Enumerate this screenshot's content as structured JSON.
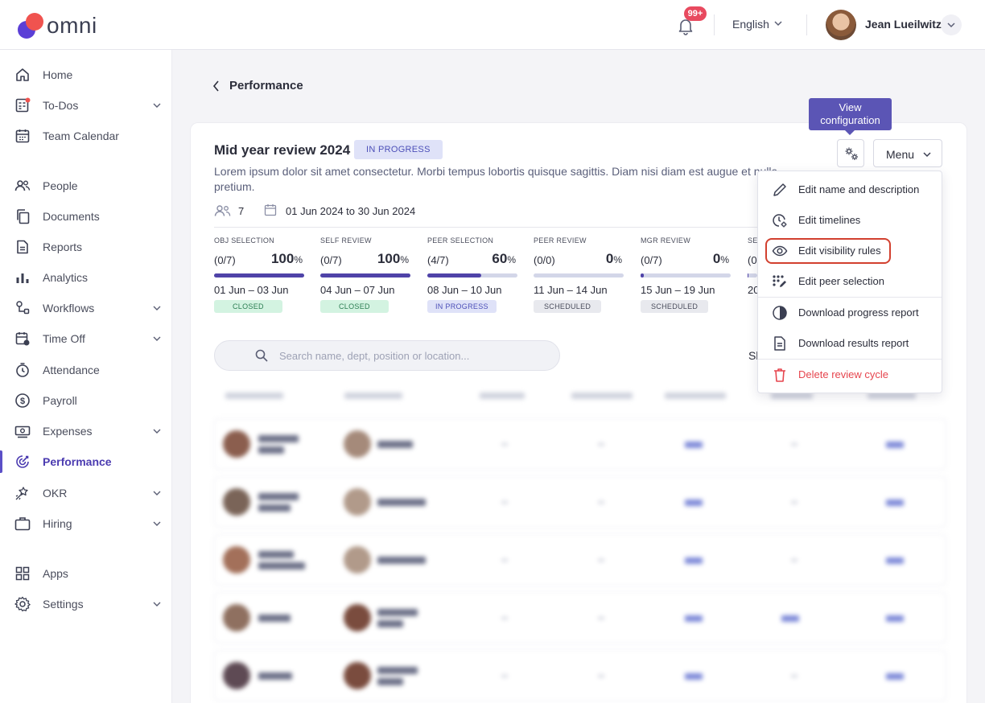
{
  "header": {
    "logo_text": "omni",
    "notification_count": "99+",
    "language": "English",
    "user_name": "Jean Lueilwitz"
  },
  "sidebar": {
    "items": [
      {
        "label": "Home",
        "icon": "home-icon",
        "has_chevron": false
      },
      {
        "label": "To-Dos",
        "icon": "todos-icon",
        "has_chevron": true
      },
      {
        "label": "Team Calendar",
        "icon": "calendar-icon",
        "has_chevron": false
      },
      {
        "label": "People",
        "icon": "people-icon",
        "has_chevron": false
      },
      {
        "label": "Documents",
        "icon": "documents-icon",
        "has_chevron": false
      },
      {
        "label": "Reports",
        "icon": "reports-icon",
        "has_chevron": false
      },
      {
        "label": "Analytics",
        "icon": "analytics-icon",
        "has_chevron": false
      },
      {
        "label": "Workflows",
        "icon": "workflows-icon",
        "has_chevron": true
      },
      {
        "label": "Time Off",
        "icon": "time-off-icon",
        "has_chevron": true
      },
      {
        "label": "Attendance",
        "icon": "attendance-icon",
        "has_chevron": false
      },
      {
        "label": "Payroll",
        "icon": "payroll-icon",
        "has_chevron": false
      },
      {
        "label": "Expenses",
        "icon": "expenses-icon",
        "has_chevron": true
      },
      {
        "label": "Performance",
        "icon": "performance-icon",
        "has_chevron": false,
        "active": true
      },
      {
        "label": "OKR",
        "icon": "okr-icon",
        "has_chevron": true
      },
      {
        "label": "Hiring",
        "icon": "hiring-icon",
        "has_chevron": true
      },
      {
        "label": "Apps",
        "icon": "apps-icon",
        "has_chevron": false
      },
      {
        "label": "Settings",
        "icon": "settings-icon",
        "has_chevron": true
      }
    ]
  },
  "page": {
    "back_label": "Performance",
    "title": "Mid year review 2024",
    "status": "IN PROGRESS",
    "description": "Lorem ipsum dolor sit amet consectetur. Morbi tempus lobortis quisque sagittis. Diam nisi diam est augue et nulla pretium.",
    "participants": "7",
    "date_range": "01 Jun 2024 to 30 Jun 2024",
    "search_placeholder": "Search name, dept, position or location...",
    "side_label": "Sl"
  },
  "stages": [
    {
      "name": "OBJ SELECTION",
      "fraction": "(0/7)",
      "percent": "100",
      "progress": 1.0,
      "range": "01 Jun – 03 Jun",
      "status": "CLOSED",
      "status_kind": "closed"
    },
    {
      "name": "SELF REVIEW",
      "fraction": "(0/7)",
      "percent": "100",
      "progress": 1.0,
      "range": "04 Jun – 07 Jun",
      "status": "CLOSED",
      "status_kind": "closed"
    },
    {
      "name": "PEER SELECTION",
      "fraction": "(4/7)",
      "percent": "60",
      "progress": 0.6,
      "range": "08 Jun – 10 Jun",
      "status": "IN PROGRESS",
      "status_kind": "inprog"
    },
    {
      "name": "PEER REVIEW",
      "fraction": "(0/0)",
      "percent": "0",
      "progress": 0.0,
      "range": "11 Jun – 14 Jun",
      "status": "SCHEDULED",
      "status_kind": "sched"
    },
    {
      "name": "MGR REVIEW",
      "fraction": "(0/7)",
      "percent": "0",
      "progress": 0.04,
      "range": "15 Jun – 19 Jun",
      "status": "SCHEDULED",
      "status_kind": "sched"
    },
    {
      "name": "SE",
      "fraction": "(0",
      "percent": "",
      "progress": 0.05,
      "range": "20",
      "status": "",
      "status_kind": "sched"
    }
  ],
  "tooltip": {
    "text_line1": "View",
    "text_line2": "configuration"
  },
  "menu": {
    "button_label": "Menu",
    "items": [
      {
        "label": "Edit name and description",
        "icon": "pencil-icon"
      },
      {
        "label": "Edit timelines",
        "icon": "clock-gear-icon"
      },
      {
        "label": "Edit visibility rules",
        "icon": "eye-icon",
        "highlighted": true
      },
      {
        "label": "Edit peer selection",
        "icon": "peer-selection-icon"
      },
      {
        "label": "Download progress report",
        "icon": "pie-chart-icon"
      },
      {
        "label": "Download results report",
        "icon": "document-icon"
      },
      {
        "label": "Delete review cycle",
        "icon": "trash-icon",
        "danger": true
      }
    ]
  },
  "colors": {
    "accent": "#5b55b5",
    "highlight_outline": "#d2402f",
    "danger": "#e6454e"
  }
}
